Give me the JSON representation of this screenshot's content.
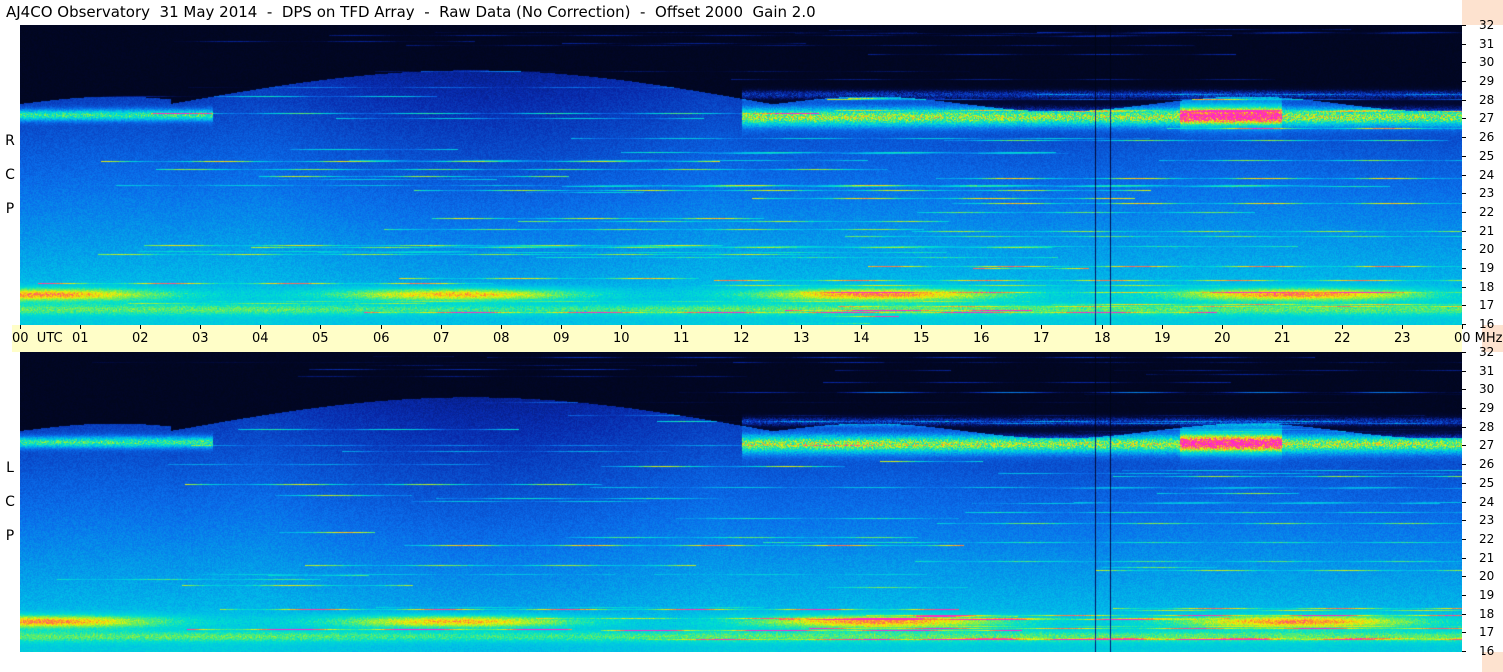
{
  "header": {
    "title": "AJ4CO Observatory  31 May 2014  -  DPS on TFD Array  -  Raw Data (No Correction)  -  Offset 2000  Gain 2.0"
  },
  "panels": {
    "top_label": [
      "R",
      "C",
      "P"
    ],
    "bottom_label": [
      "L",
      "C",
      "P"
    ]
  },
  "time_axis": {
    "labels": [
      "00",
      "01",
      "02",
      "03",
      "04",
      "05",
      "06",
      "07",
      "08",
      "09",
      "10",
      "11",
      "12",
      "13",
      "14",
      "15",
      "16",
      "17",
      "18",
      "19",
      "20",
      "21",
      "22",
      "23",
      "00"
    ],
    "utc_label": "UTC",
    "unit": "MHz"
  },
  "freq_axis": {
    "labels": [
      "32",
      "31",
      "30",
      "29",
      "28",
      "27",
      "26",
      "25",
      "24",
      "23",
      "22",
      "21",
      "20",
      "19",
      "18",
      "17",
      "16"
    ],
    "min_mhz": 16,
    "max_mhz": 32
  },
  "colors": {
    "background": "#ffffff",
    "time_axis_bg": "#fffec8",
    "right_strip_bg": "#fde2cf",
    "spectrogram_dark": "#000814",
    "spectrogram_deep_blue": "#0a2fa8",
    "spectrogram_cyan": "#00c8e8",
    "spectrogram_yellow": "#f0f000",
    "spectrogram_magenta": "#ff30c8"
  },
  "chart_data": {
    "type": "heatmap",
    "title": "AJ4CO Observatory  31 May 2014  -  DPS on TFD Array  -  Raw Data (No Correction)  -  Offset 2000  Gain 2.0",
    "xlabel": "UTC",
    "ylabel": "MHz",
    "x_range": [
      "00",
      "00"
    ],
    "ylim": [
      16,
      32
    ],
    "series": [
      {
        "name": "RCP"
      },
      {
        "name": "LCP"
      }
    ]
  }
}
